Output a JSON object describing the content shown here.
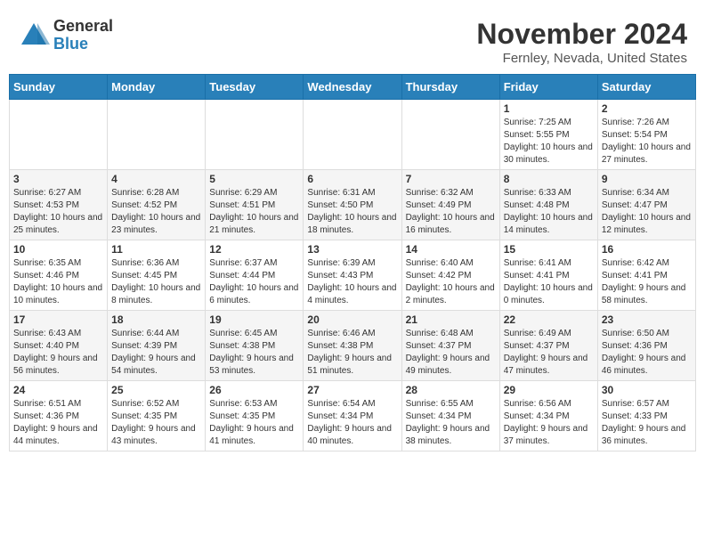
{
  "logo": {
    "general": "General",
    "blue": "Blue"
  },
  "header": {
    "title": "November 2024",
    "subtitle": "Fernley, Nevada, United States"
  },
  "weekdays": [
    "Sunday",
    "Monday",
    "Tuesday",
    "Wednesday",
    "Thursday",
    "Friday",
    "Saturday"
  ],
  "weeks": [
    {
      "days": [
        {
          "num": "",
          "info": ""
        },
        {
          "num": "",
          "info": ""
        },
        {
          "num": "",
          "info": ""
        },
        {
          "num": "",
          "info": ""
        },
        {
          "num": "",
          "info": ""
        },
        {
          "num": "1",
          "info": "Sunrise: 7:25 AM\nSunset: 5:55 PM\nDaylight: 10 hours and 30 minutes."
        },
        {
          "num": "2",
          "info": "Sunrise: 7:26 AM\nSunset: 5:54 PM\nDaylight: 10 hours and 27 minutes."
        }
      ]
    },
    {
      "days": [
        {
          "num": "3",
          "info": "Sunrise: 6:27 AM\nSunset: 4:53 PM\nDaylight: 10 hours and 25 minutes."
        },
        {
          "num": "4",
          "info": "Sunrise: 6:28 AM\nSunset: 4:52 PM\nDaylight: 10 hours and 23 minutes."
        },
        {
          "num": "5",
          "info": "Sunrise: 6:29 AM\nSunset: 4:51 PM\nDaylight: 10 hours and 21 minutes."
        },
        {
          "num": "6",
          "info": "Sunrise: 6:31 AM\nSunset: 4:50 PM\nDaylight: 10 hours and 18 minutes."
        },
        {
          "num": "7",
          "info": "Sunrise: 6:32 AM\nSunset: 4:49 PM\nDaylight: 10 hours and 16 minutes."
        },
        {
          "num": "8",
          "info": "Sunrise: 6:33 AM\nSunset: 4:48 PM\nDaylight: 10 hours and 14 minutes."
        },
        {
          "num": "9",
          "info": "Sunrise: 6:34 AM\nSunset: 4:47 PM\nDaylight: 10 hours and 12 minutes."
        }
      ]
    },
    {
      "days": [
        {
          "num": "10",
          "info": "Sunrise: 6:35 AM\nSunset: 4:46 PM\nDaylight: 10 hours and 10 minutes."
        },
        {
          "num": "11",
          "info": "Sunrise: 6:36 AM\nSunset: 4:45 PM\nDaylight: 10 hours and 8 minutes."
        },
        {
          "num": "12",
          "info": "Sunrise: 6:37 AM\nSunset: 4:44 PM\nDaylight: 10 hours and 6 minutes."
        },
        {
          "num": "13",
          "info": "Sunrise: 6:39 AM\nSunset: 4:43 PM\nDaylight: 10 hours and 4 minutes."
        },
        {
          "num": "14",
          "info": "Sunrise: 6:40 AM\nSunset: 4:42 PM\nDaylight: 10 hours and 2 minutes."
        },
        {
          "num": "15",
          "info": "Sunrise: 6:41 AM\nSunset: 4:41 PM\nDaylight: 10 hours and 0 minutes."
        },
        {
          "num": "16",
          "info": "Sunrise: 6:42 AM\nSunset: 4:41 PM\nDaylight: 9 hours and 58 minutes."
        }
      ]
    },
    {
      "days": [
        {
          "num": "17",
          "info": "Sunrise: 6:43 AM\nSunset: 4:40 PM\nDaylight: 9 hours and 56 minutes."
        },
        {
          "num": "18",
          "info": "Sunrise: 6:44 AM\nSunset: 4:39 PM\nDaylight: 9 hours and 54 minutes."
        },
        {
          "num": "19",
          "info": "Sunrise: 6:45 AM\nSunset: 4:38 PM\nDaylight: 9 hours and 53 minutes."
        },
        {
          "num": "20",
          "info": "Sunrise: 6:46 AM\nSunset: 4:38 PM\nDaylight: 9 hours and 51 minutes."
        },
        {
          "num": "21",
          "info": "Sunrise: 6:48 AM\nSunset: 4:37 PM\nDaylight: 9 hours and 49 minutes."
        },
        {
          "num": "22",
          "info": "Sunrise: 6:49 AM\nSunset: 4:37 PM\nDaylight: 9 hours and 47 minutes."
        },
        {
          "num": "23",
          "info": "Sunrise: 6:50 AM\nSunset: 4:36 PM\nDaylight: 9 hours and 46 minutes."
        }
      ]
    },
    {
      "days": [
        {
          "num": "24",
          "info": "Sunrise: 6:51 AM\nSunset: 4:36 PM\nDaylight: 9 hours and 44 minutes."
        },
        {
          "num": "25",
          "info": "Sunrise: 6:52 AM\nSunset: 4:35 PM\nDaylight: 9 hours and 43 minutes."
        },
        {
          "num": "26",
          "info": "Sunrise: 6:53 AM\nSunset: 4:35 PM\nDaylight: 9 hours and 41 minutes."
        },
        {
          "num": "27",
          "info": "Sunrise: 6:54 AM\nSunset: 4:34 PM\nDaylight: 9 hours and 40 minutes."
        },
        {
          "num": "28",
          "info": "Sunrise: 6:55 AM\nSunset: 4:34 PM\nDaylight: 9 hours and 38 minutes."
        },
        {
          "num": "29",
          "info": "Sunrise: 6:56 AM\nSunset: 4:34 PM\nDaylight: 9 hours and 37 minutes."
        },
        {
          "num": "30",
          "info": "Sunrise: 6:57 AM\nSunset: 4:33 PM\nDaylight: 9 hours and 36 minutes."
        }
      ]
    }
  ]
}
